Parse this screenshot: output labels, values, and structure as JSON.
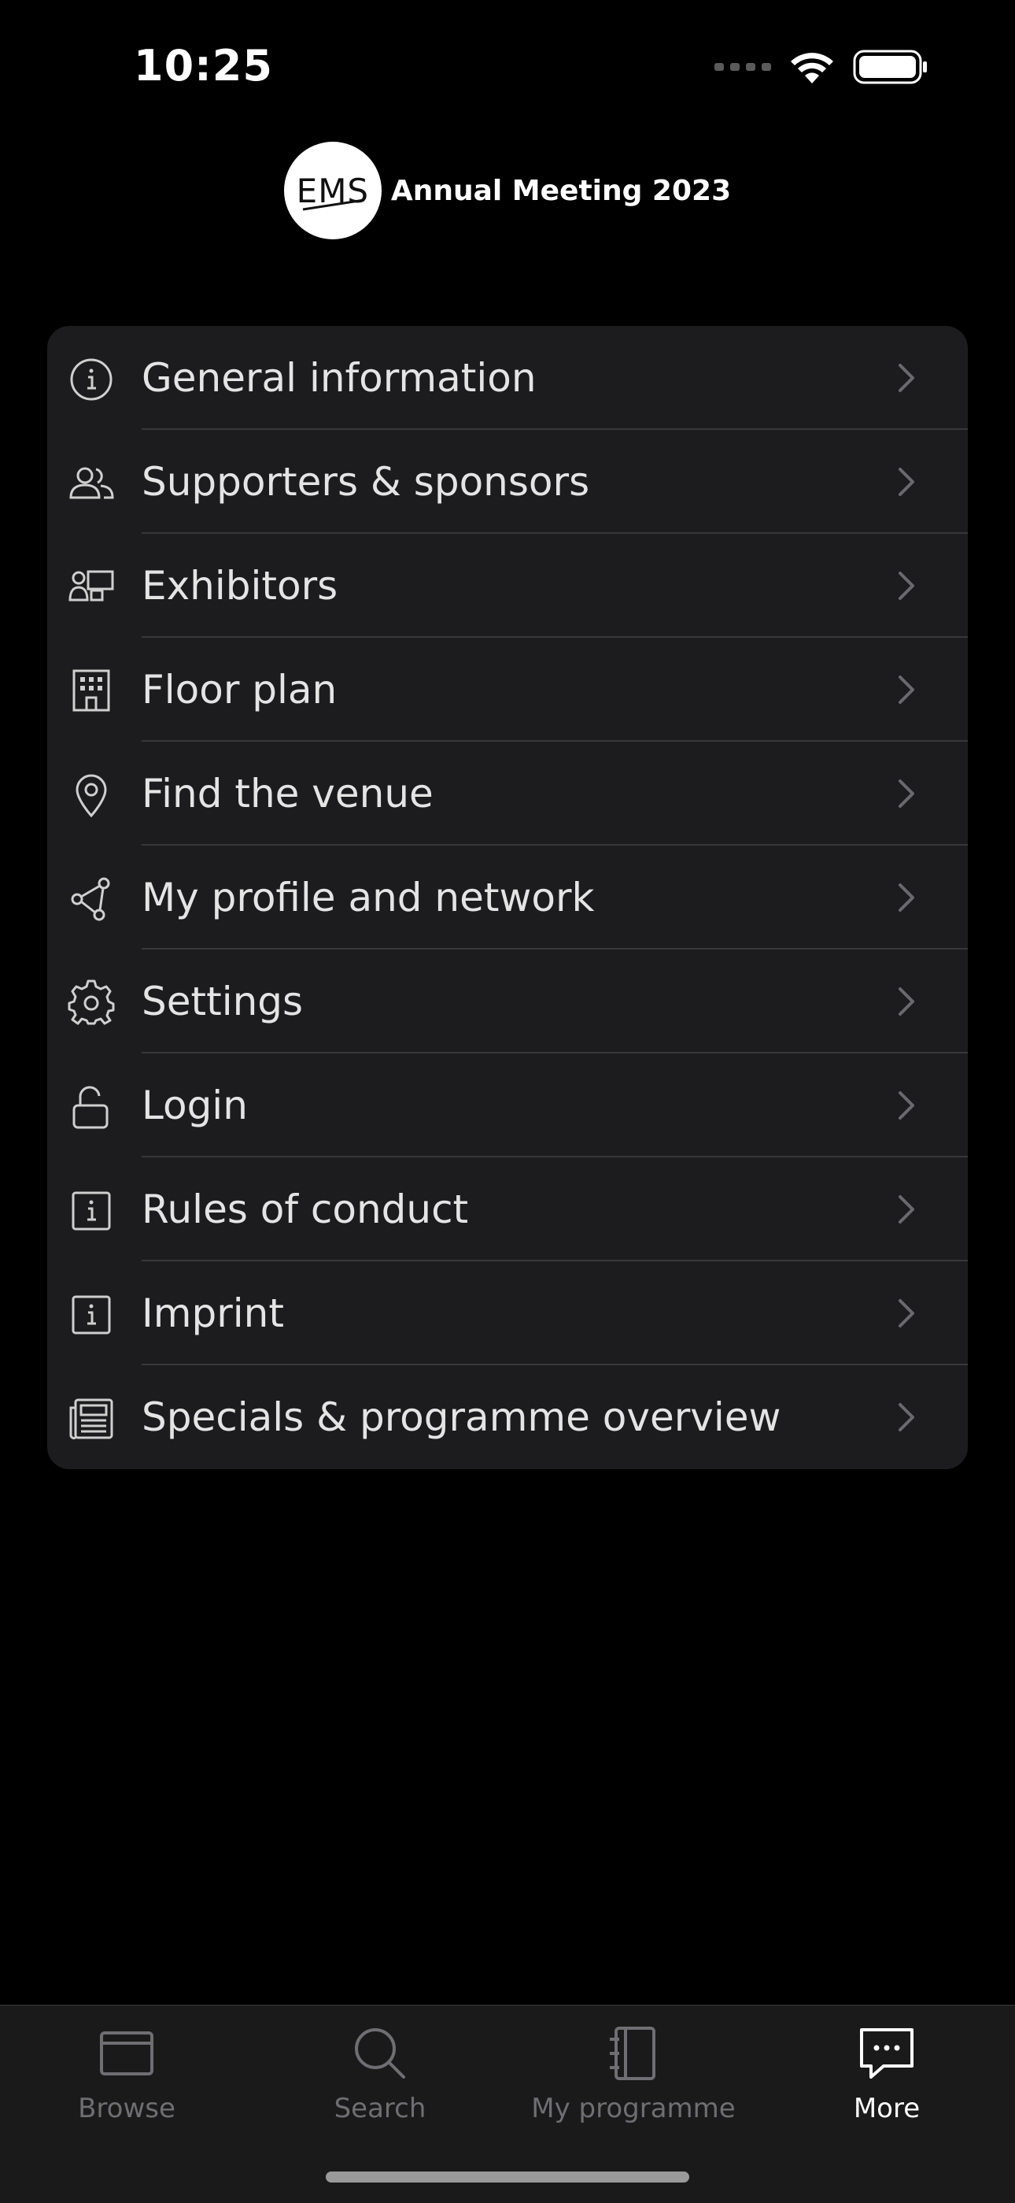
{
  "status_bar": {
    "time": "10:25"
  },
  "header": {
    "logo_text": "EMS",
    "title": "Annual Meeting 2023"
  },
  "menu": {
    "items": [
      {
        "label": "General information",
        "icon": "info-circle-icon"
      },
      {
        "label": "Supporters & sponsors",
        "icon": "people-icon"
      },
      {
        "label": "Exhibitors",
        "icon": "presenter-icon"
      },
      {
        "label": "Floor plan",
        "icon": "building-icon"
      },
      {
        "label": "Find the venue",
        "icon": "map-pin-icon"
      },
      {
        "label": "My profile and network",
        "icon": "network-icon"
      },
      {
        "label": "Settings",
        "icon": "gear-icon"
      },
      {
        "label": "Login",
        "icon": "unlock-icon"
      },
      {
        "label": "Rules of conduct",
        "icon": "info-square-icon"
      },
      {
        "label": "Imprint",
        "icon": "info-square-icon"
      },
      {
        "label": "Specials & programme overview",
        "icon": "newspaper-icon"
      }
    ]
  },
  "tab_bar": {
    "tabs": [
      {
        "label": "Browse",
        "icon": "browser-window-icon",
        "active": false
      },
      {
        "label": "Search",
        "icon": "magnifier-icon",
        "active": false
      },
      {
        "label": "My programme",
        "icon": "notebook-icon",
        "active": false
      },
      {
        "label": "More",
        "icon": "chat-bubble-icon",
        "active": true
      }
    ]
  },
  "colors": {
    "background": "#000000",
    "card": "#1c1c1e",
    "divider": "#38383a",
    "text": "#e4e4e4",
    "tab_inactive": "#6e6e73",
    "tab_active": "#ffffff"
  }
}
